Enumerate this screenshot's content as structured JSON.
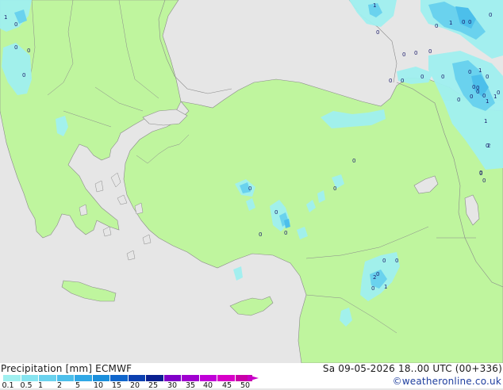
{
  "map": {
    "labels": [
      "1",
      "0",
      "0",
      "0",
      "0",
      "1",
      "0",
      "1",
      "0",
      "0",
      "0",
      "0",
      "0",
      "0",
      "0",
      "0",
      "0",
      "0",
      "0",
      "0",
      "1",
      "0",
      "0",
      "0",
      "0",
      "0",
      "0",
      "1",
      "1",
      "0",
      "0",
      "0",
      "0",
      "0",
      "0",
      "0",
      "0",
      "0",
      "0",
      "0",
      "0",
      "1",
      "2",
      "0",
      "0",
      "1",
      "0",
      "0",
      "2"
    ]
  },
  "footer": {
    "title_left": "Precipitation [mm]  ECMWF",
    "title_right": "Sa 09-05-2026 18..00 UTC (00+336)",
    "credit": "©weatheronline.co.uk"
  },
  "legend": {
    "colors": [
      "#a0f0f0",
      "#86e4f0",
      "#6ad2ee",
      "#4cbfeb",
      "#30a8e6",
      "#1a8fdc",
      "#1066cc",
      "#0c40b0",
      "#0a2090",
      "#8000c8",
      "#a000d0",
      "#c000d8",
      "#d800c8",
      "#c800a8"
    ],
    "labels": [
      "0.1",
      "0.5",
      "1",
      "2",
      "5",
      "10",
      "15",
      "20",
      "25",
      "30",
      "35",
      "40",
      "45",
      "50"
    ]
  }
}
